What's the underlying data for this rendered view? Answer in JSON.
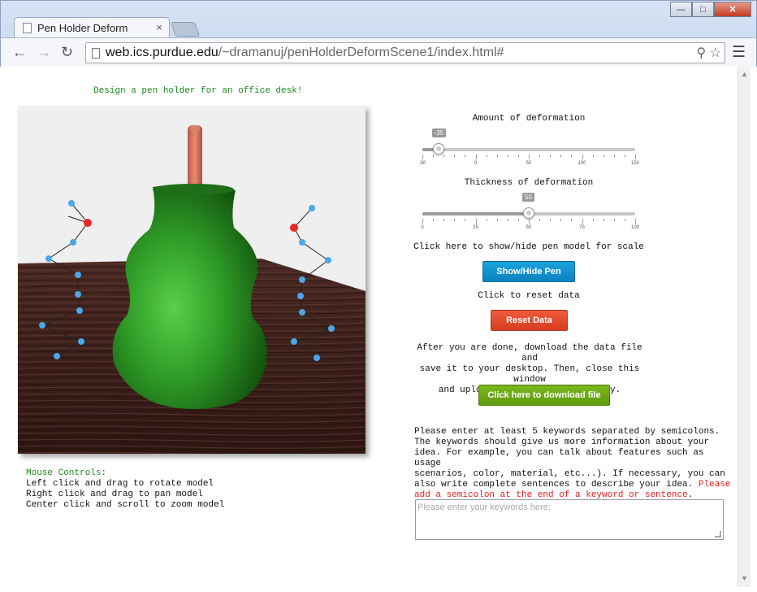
{
  "browser": {
    "tab_title": "Pen Holder Deform",
    "tab_close": "×",
    "url_host": "web.ics.purdue.edu",
    "url_path": "/~dramanuj/penHolderDeformScene1/index.html#",
    "window_buttons": {
      "minimize": "—",
      "maximize": "□",
      "close": "✕"
    }
  },
  "page": {
    "design_title": "Design a pen holder for an office desk!",
    "mouse_controls": {
      "title": "Mouse Controls:",
      "lines": [
        "Left click and drag to rotate model",
        "Right click and drag to pan model",
        "Center click and scroll to zoom model"
      ]
    },
    "deformation_amount": {
      "label": "Amount of deformation",
      "value": "-35",
      "min": -50,
      "max": 150,
      "current": -35,
      "tick_labels": [
        "-50",
        "0",
        "50",
        "100",
        "150"
      ]
    },
    "deformation_thickness": {
      "label": "Thickness of deformation",
      "value": "50",
      "min": 0,
      "max": 100,
      "current": 50,
      "tick_labels": [
        "0",
        "25",
        "50",
        "75",
        "100"
      ]
    },
    "pen_toggle": {
      "caption": "Click here to show/hide pen model for scale",
      "button": "Show/Hide Pen"
    },
    "reset": {
      "caption": "Click to reset data",
      "button": "Reset Data"
    },
    "download": {
      "instructions": [
        "After you are done, download the data file and",
        "save it to your desktop. Then, close this window",
        "and upload the file to the survey."
      ],
      "button": "Click here to download file"
    },
    "keywords": {
      "instructions": [
        "Please enter at least 5 keywords separated by semicolons.",
        "The keywords should give us more information about your",
        "idea. For example, you can talk about features such as usage",
        "scenarios, color, material, etc...). If necessary, you can",
        "also write complete sentences to describe your idea. "
      ],
      "warning_part1": "Please",
      "warning_part2": "add a semicolon at the end of a keyword or sentence",
      "warning_end": ".",
      "placeholder": "Please enter your keywords here;"
    }
  },
  "colors": {
    "title_green": "#1e8a1e",
    "warning_red": "#e02020",
    "show_hide_blue": "#0a82c0",
    "reset_red": "#d63d20",
    "download_green": "#5f9a0c"
  }
}
